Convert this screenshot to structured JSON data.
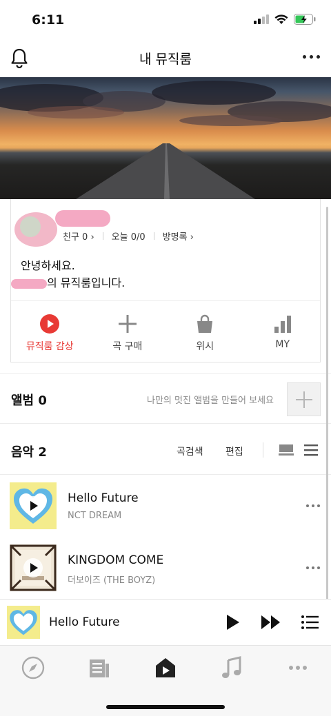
{
  "status": {
    "time": "6:11"
  },
  "header": {
    "title": "내 뮤직룸"
  },
  "profile": {
    "friends": "친구 0",
    "today": "오늘 0/0",
    "guestbook": "방명록",
    "greeting_line1": "안녕하세요.",
    "greeting_line2": "의 뮤직룸입니다."
  },
  "actions": [
    {
      "label": "뮤직룸 감상",
      "icon": "play-circle-icon",
      "active": true
    },
    {
      "label": "곡 구매",
      "icon": "plus-icon"
    },
    {
      "label": "위시",
      "icon": "shopping-bag-icon"
    },
    {
      "label": "MY",
      "icon": "bar-chart-icon"
    }
  ],
  "album": {
    "title": "앨범 0",
    "hint": "나만의 멋진 앨범을 만들어 보세요"
  },
  "music": {
    "title": "음악 2",
    "search_label": "곡검색",
    "edit_label": "편집",
    "tracks": [
      {
        "title": "Hello Future",
        "artist": "NCT DREAM"
      },
      {
        "title": "KINGDOM COME",
        "artist": "더보이즈 (THE BOYZ)"
      }
    ]
  },
  "player": {
    "title": "Hello Future"
  },
  "tabs": [
    "compass-icon",
    "news-icon",
    "home-music-icon",
    "music-note-icon",
    "more-icon"
  ],
  "colors": {
    "accent": "#e83a35",
    "text": "#111111",
    "muted": "#888888"
  }
}
